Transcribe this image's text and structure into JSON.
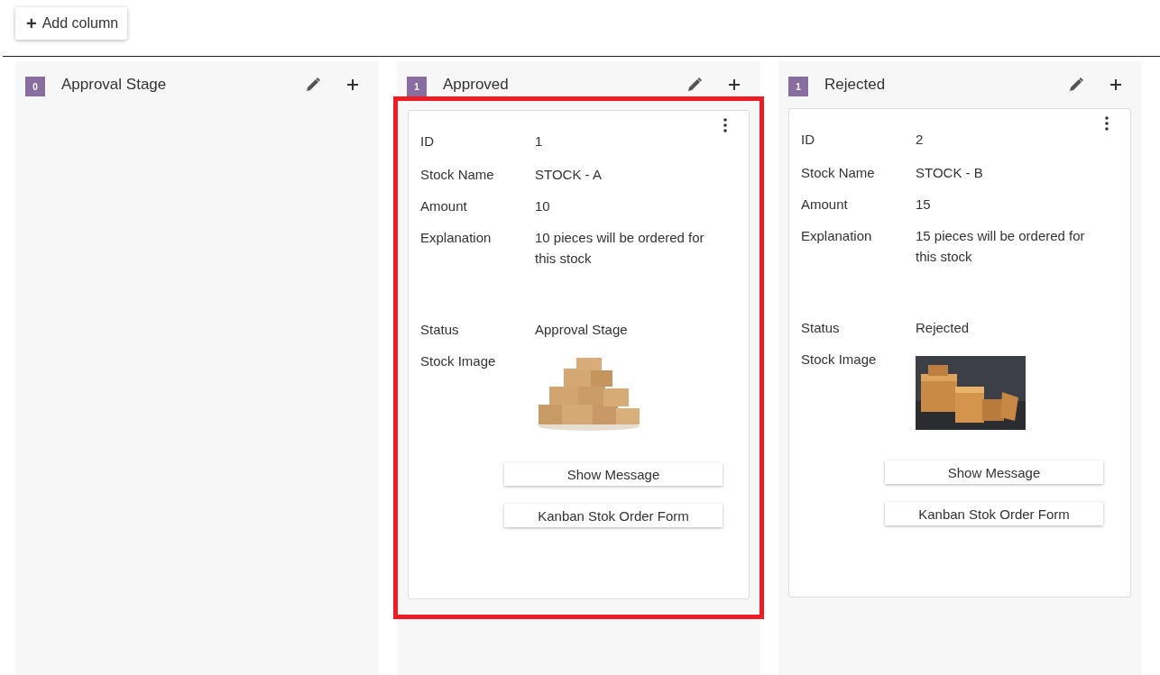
{
  "toolbar": {
    "add_column": {
      "icon": "+",
      "label": "Add column"
    }
  },
  "columns": [
    {
      "title": "Approval Stage",
      "count": "0"
    },
    {
      "title": "Approved",
      "count": "1",
      "cards": [
        {
          "highlighted": true,
          "fields": [
            {
              "kind": "text",
              "label": "ID",
              "value": "1"
            },
            {
              "kind": "text",
              "label": "Stock Name",
              "value": "STOCK - A"
            },
            {
              "kind": "text",
              "label": "Amount",
              "value": "10"
            },
            {
              "kind": "text",
              "label": "Explanation",
              "value": "10 pieces will be ordered for this stock"
            },
            {
              "kind": "text",
              "label": "Status",
              "value": "Approval Stage"
            },
            {
              "kind": "picture",
              "label": "Stock Image"
            }
          ],
          "buttons": [
            "Show Message",
            "Kanban Stok Order Form"
          ]
        }
      ]
    },
    {
      "title": "Rejected",
      "count": "1",
      "cards": [
        {
          "highlighted": false,
          "fields": [
            {
              "kind": "text",
              "label": "ID",
              "value": "2"
            },
            {
              "kind": "text",
              "label": "Stock Name",
              "value": "STOCK - B"
            },
            {
              "kind": "text",
              "label": "Amount",
              "value": "15"
            },
            {
              "kind": "text",
              "label": "Explanation",
              "value": "15 pieces will be ordered for this stock"
            },
            {
              "kind": "text",
              "label": "Status",
              "value": "Rejected"
            },
            {
              "kind": "picture",
              "label": "Stock Image"
            }
          ],
          "buttons": [
            "Show Message",
            "Kanban Stok Order Form"
          ]
        }
      ]
    }
  ]
}
